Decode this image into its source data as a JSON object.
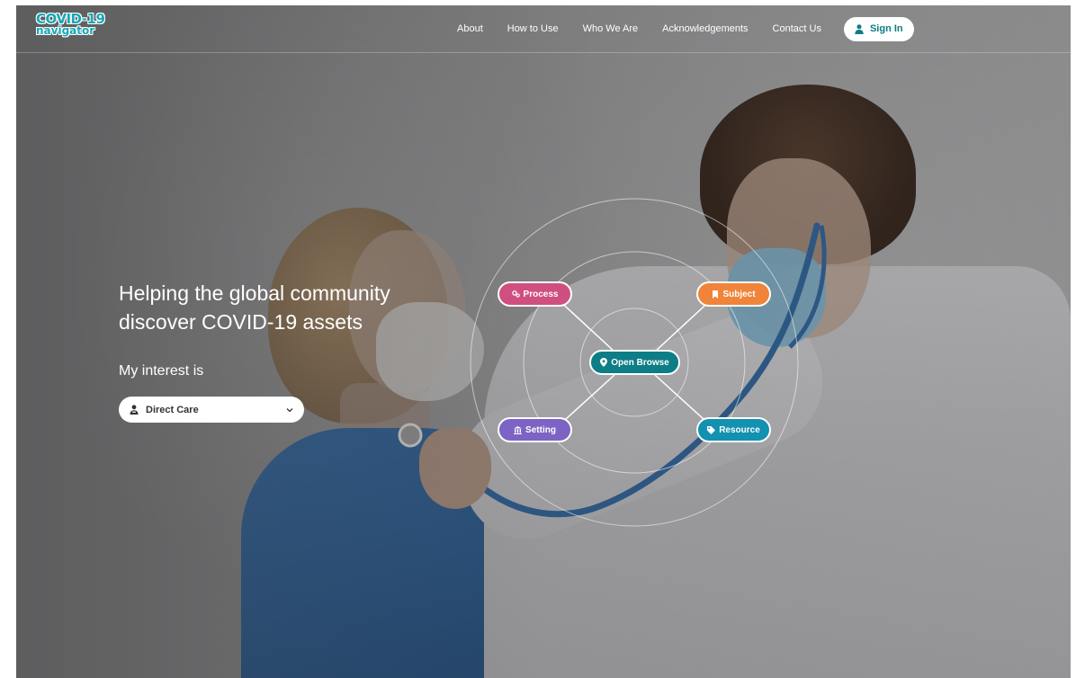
{
  "logo": {
    "line1": "COVID-19",
    "line2": "navigator"
  },
  "nav": {
    "items": [
      {
        "label": "About"
      },
      {
        "label": "How to Use"
      },
      {
        "label": "Who We Are"
      },
      {
        "label": "Acknowledgements"
      },
      {
        "label": "Contact Us"
      }
    ],
    "sign_in": "Sign In"
  },
  "hero": {
    "headline_line1": "Helping the global community",
    "headline_line2": "discover COVID-19 assets",
    "interest_label": "My interest is",
    "interest_select": {
      "selected": "Direct Care"
    }
  },
  "diagram": {
    "center": {
      "label": "Open Browse",
      "color": "#0d7d86",
      "icon": "map-marker-icon"
    },
    "nodes": [
      {
        "key": "process",
        "label": "Process",
        "color": "#cf4f80",
        "icon": "cogs-icon"
      },
      {
        "key": "subject",
        "label": "Subject",
        "color": "#f0843a",
        "icon": "bookmark-icon"
      },
      {
        "key": "setting",
        "label": "Setting",
        "color": "#7d63c4",
        "icon": "building-icon"
      },
      {
        "key": "resource",
        "label": "Resource",
        "color": "#1291b0",
        "icon": "tag-icon"
      }
    ]
  },
  "colors": {
    "accent": "#17a7b5",
    "sign_in_text": "#0b7d86"
  }
}
